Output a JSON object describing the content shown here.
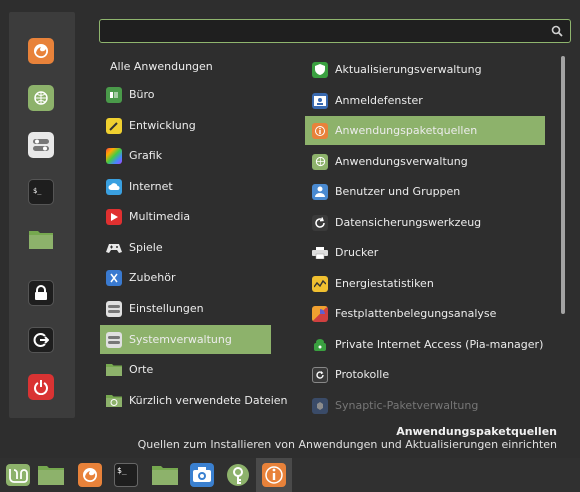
{
  "search": {
    "value": "",
    "placeholder": ""
  },
  "favorites": [
    {
      "name": "firefox-icon"
    },
    {
      "name": "software-manager-icon"
    },
    {
      "name": "system-settings-icon"
    },
    {
      "name": "terminal-icon"
    },
    {
      "name": "files-icon"
    },
    {
      "name": "lock-screen-icon"
    },
    {
      "name": "logout-icon"
    },
    {
      "name": "shutdown-icon"
    }
  ],
  "categories_heading": "Alle Anwendungen",
  "categories": [
    {
      "label": "Büro",
      "icon": "office-icon"
    },
    {
      "label": "Entwicklung",
      "icon": "development-icon"
    },
    {
      "label": "Grafik",
      "icon": "graphics-icon"
    },
    {
      "label": "Internet",
      "icon": "internet-icon"
    },
    {
      "label": "Multimedia",
      "icon": "multimedia-icon"
    },
    {
      "label": "Spiele",
      "icon": "games-icon"
    },
    {
      "label": "Zubehör",
      "icon": "accessories-icon"
    },
    {
      "label": "Einstellungen",
      "icon": "preferences-icon"
    },
    {
      "label": "Systemverwaltung",
      "icon": "administration-icon",
      "selected": true
    },
    {
      "label": "Orte",
      "icon": "places-icon"
    },
    {
      "label": "Kürzlich verwendete Dateien",
      "icon": "recent-files-icon"
    }
  ],
  "apps": [
    {
      "label": "Aktualisierungsverwaltung",
      "icon": "update-shield-icon"
    },
    {
      "label": "Anmeldefenster",
      "icon": "login-window-icon"
    },
    {
      "label": "Anwendungspaketquellen",
      "icon": "info-icon",
      "selected": true
    },
    {
      "label": "Anwendungsverwaltung",
      "icon": "software-manager-icon"
    },
    {
      "label": "Benutzer und Gruppen",
      "icon": "users-icon"
    },
    {
      "label": "Datensicherungswerkzeug",
      "icon": "backup-icon"
    },
    {
      "label": "Drucker",
      "icon": "printer-icon"
    },
    {
      "label": "Energiestatistiken",
      "icon": "power-stats-icon"
    },
    {
      "label": "Festplattenbelegungsanalyse",
      "icon": "disk-usage-icon"
    },
    {
      "label": "Private Internet Access (Pia-manager)",
      "icon": "pia-icon"
    },
    {
      "label": "Protokolle",
      "icon": "logs-icon"
    },
    {
      "label": "Synaptic-Paketverwaltung",
      "icon": "synaptic-icon",
      "dimmed": true
    }
  ],
  "description": {
    "title": "Anwendungspaketquellen",
    "text": "Quellen zum Installieren von Anwendungen und Aktualisierungen einrichten"
  },
  "taskbar": [
    {
      "name": "mint-menu-icon"
    },
    {
      "name": "show-desktop-icon"
    },
    {
      "name": "firefox-icon"
    },
    {
      "name": "terminal-icon"
    },
    {
      "name": "files-icon"
    },
    {
      "name": "screenshot-icon"
    },
    {
      "name": "keyring-icon"
    },
    {
      "name": "software-sources-icon",
      "active": true
    }
  ],
  "colors": {
    "accent": "#8db26b",
    "background": "#2e2e2e",
    "sidebar": "#3c3c3c"
  }
}
